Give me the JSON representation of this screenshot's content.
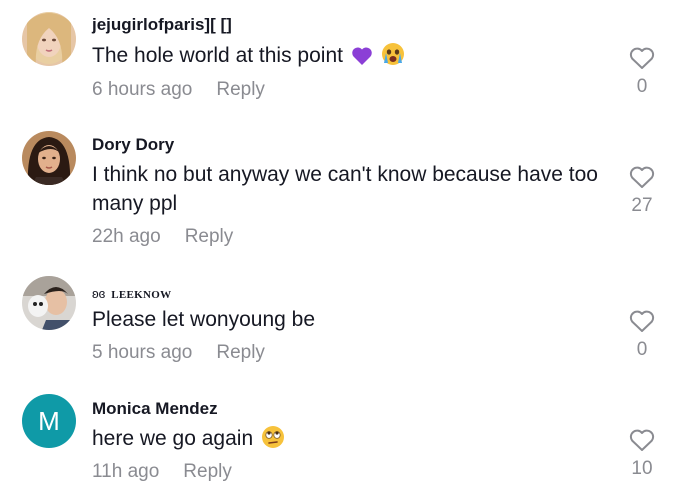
{
  "comments": [
    {
      "username": "jejugirlofparis][ []",
      "text": "The hole world at this point",
      "emojis": [
        "purple-heart-emoji",
        "crying-face-emoji"
      ],
      "time": "6 hours ago",
      "reply_label": "Reply",
      "likes": "0",
      "avatar": "photo-blonde"
    },
    {
      "username": "Dory Dory",
      "text": "I think no but anyway we can't know because have too many ppl",
      "time": "22h ago",
      "reply_label": "Reply",
      "likes": "27",
      "avatar": "photo-dark-hair"
    },
    {
      "username_prefix": "ʚɞ",
      "username": "LEEKNOW",
      "text": "Please let wonyoung be",
      "time": "5 hours ago",
      "reply_label": "Reply",
      "likes": "0",
      "avatar": "photo-selfie"
    },
    {
      "username": "Monica Mendez",
      "text": "here we go again",
      "emojis": [
        "eye-roll-emoji"
      ],
      "time": "11h ago",
      "reply_label": "Reply",
      "likes": "10",
      "avatar_letter": "M",
      "avatar_color": "#0f9aa7"
    }
  ],
  "colors": {
    "primary_text": "#161823",
    "secondary_text": "#8a8b91",
    "like_icon": "#8a8b91"
  }
}
